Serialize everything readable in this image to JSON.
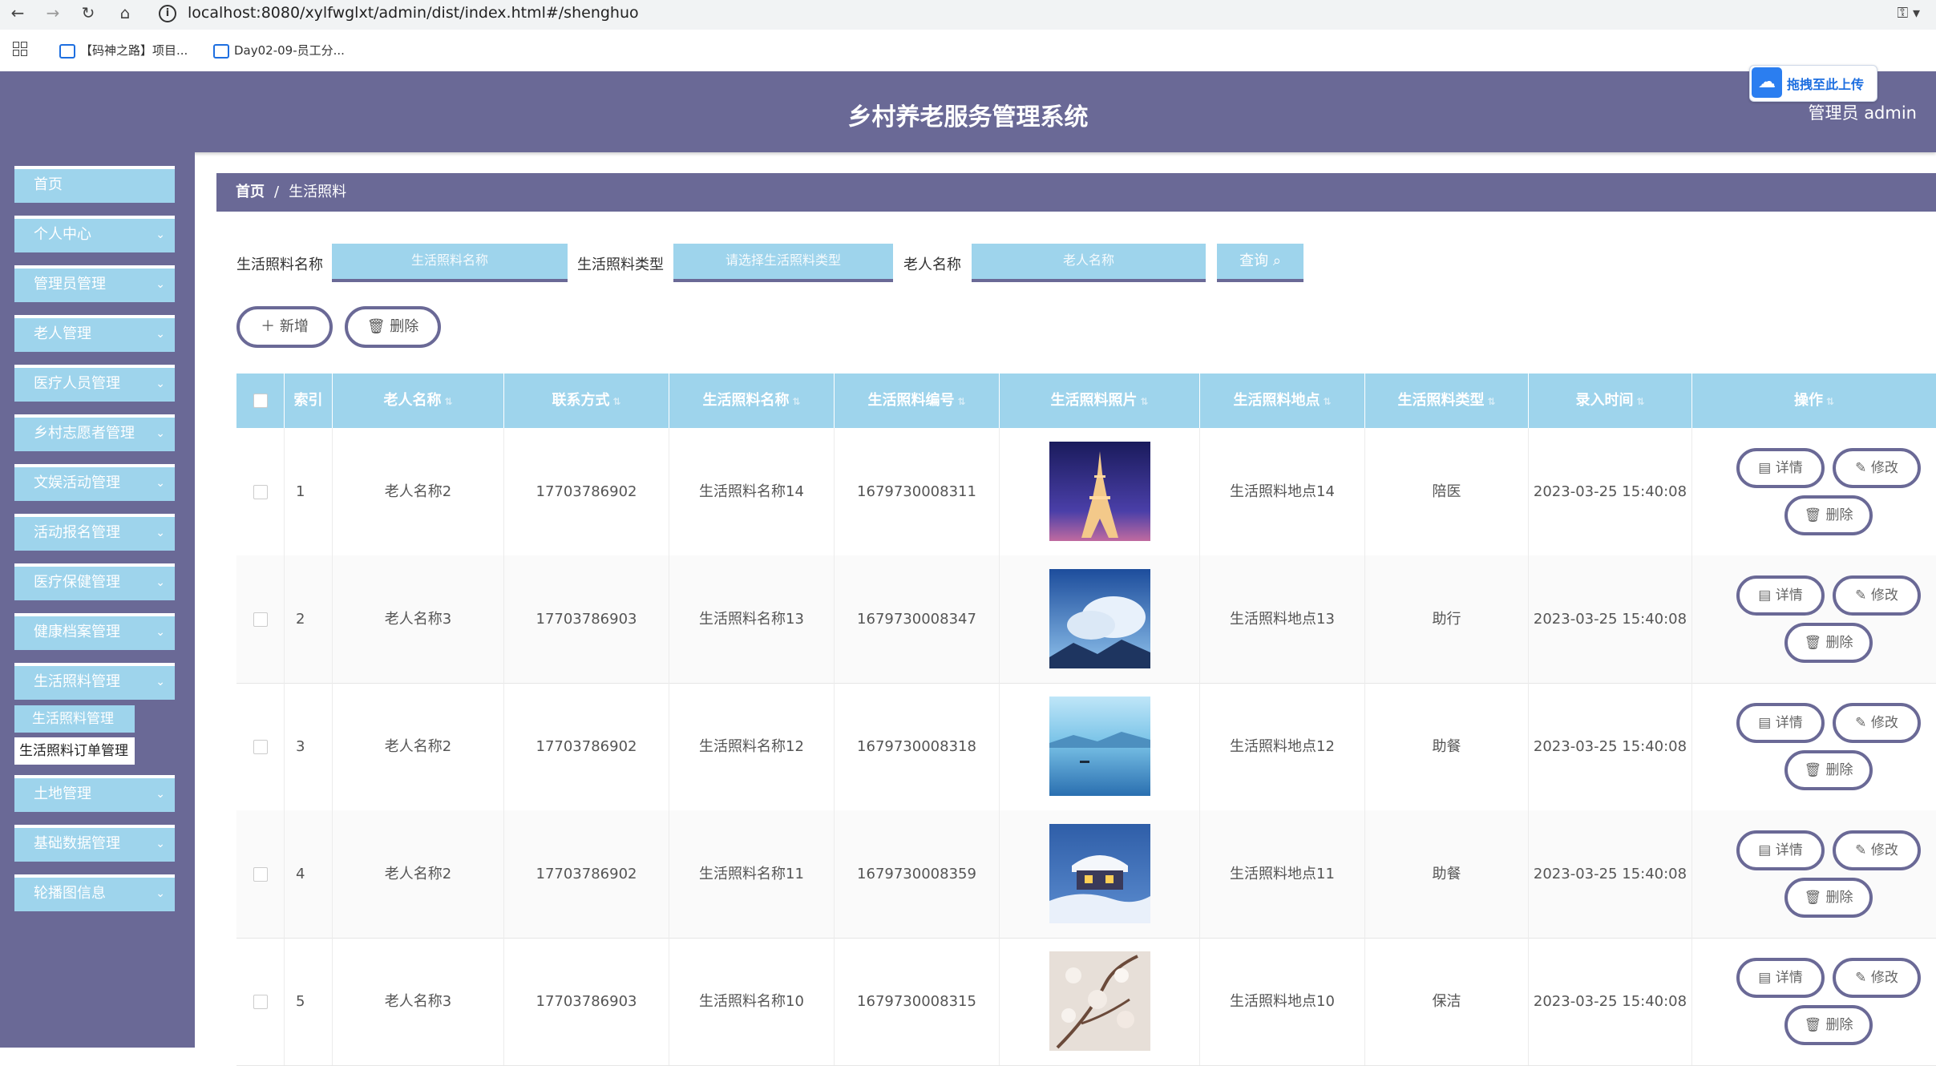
{
  "browser": {
    "url": "localhost:8080/xylfwglxt/admin/dist/index.html#/shenghuo",
    "bookmarks": [
      "【码神之路】项目...",
      "Day02-09-员工分..."
    ]
  },
  "header": {
    "title": "乡村养老服务管理系统",
    "user": "管理员 admin",
    "upload_label": "拖拽至此上传"
  },
  "sidebar": {
    "items": [
      {
        "label": "首页",
        "has_children": false
      },
      {
        "label": "个人中心",
        "has_children": true
      },
      {
        "label": "管理员管理",
        "has_children": true
      },
      {
        "label": "老人管理",
        "has_children": true
      },
      {
        "label": "医疗人员管理",
        "has_children": true
      },
      {
        "label": "乡村志愿者管理",
        "has_children": true
      },
      {
        "label": "文娱活动管理",
        "has_children": true
      },
      {
        "label": "活动报名管理",
        "has_children": true
      },
      {
        "label": "医疗保健管理",
        "has_children": true
      },
      {
        "label": "健康档案管理",
        "has_children": true
      },
      {
        "label": "生活照料管理",
        "has_children": true
      },
      {
        "label": "土地管理",
        "has_children": true
      },
      {
        "label": "基础数据管理",
        "has_children": true
      },
      {
        "label": "轮播图信息",
        "has_children": true
      }
    ],
    "submenu": [
      "生活照料管理",
      "生活照料订单管理"
    ]
  },
  "breadcrumb": {
    "home": "首页",
    "separator": "/",
    "current": "生活照料"
  },
  "search": {
    "name_label": "生活照料名称",
    "name_placeholder": "生活照料名称",
    "type_label": "生活照料类型",
    "type_placeholder": "请选择生活照料类型",
    "elder_label": "老人名称",
    "elder_placeholder": "老人名称",
    "query_label": "查询"
  },
  "actions": {
    "add_label": "新增",
    "delete_label": "删除"
  },
  "table": {
    "headers": [
      "索引",
      "老人名称",
      "联系方式",
      "生活照料名称",
      "生活照料编号",
      "生活照料照片",
      "生活照料地点",
      "生活照料类型",
      "录入时间",
      "操作"
    ],
    "rows": [
      {
        "index": "1",
        "elder": "老人名称2",
        "phone": "17703786902",
        "name": "生活照料名称14",
        "code": "1679730008311",
        "photo": "eiffel-tower-night",
        "place": "生活照料地点14",
        "type": "陪医",
        "time": "2023-03-25 15:40:08"
      },
      {
        "index": "2",
        "elder": "老人名称3",
        "phone": "17703786903",
        "name": "生活照料名称13",
        "code": "1679730008347",
        "photo": "cloudy-sky",
        "place": "生活照料地点13",
        "type": "助行",
        "time": "2023-03-25 15:40:08"
      },
      {
        "index": "3",
        "elder": "老人名称2",
        "phone": "17703786902",
        "name": "生活照料名称12",
        "code": "1679730008318",
        "photo": "lake-boat",
        "place": "生活照料地点12",
        "type": "助餐",
        "time": "2023-03-25 15:40:08"
      },
      {
        "index": "4",
        "elder": "老人名称2",
        "phone": "17703786902",
        "name": "生活照料名称11",
        "code": "1679730008359",
        "photo": "snow-cabin",
        "place": "生活照料地点11",
        "type": "助餐",
        "time": "2023-03-25 15:40:08"
      },
      {
        "index": "5",
        "elder": "老人名称3",
        "phone": "17703786903",
        "name": "生活照料名称10",
        "code": "1679730008315",
        "photo": "blossom-branch",
        "place": "生活照料地点10",
        "type": "保洁",
        "time": "2023-03-25 15:40:08"
      }
    ],
    "row_actions": {
      "detail": "详情",
      "edit": "修改",
      "delete": "删除"
    }
  },
  "colors": {
    "header": "#6a6996",
    "accent": "#9ed4ec"
  }
}
